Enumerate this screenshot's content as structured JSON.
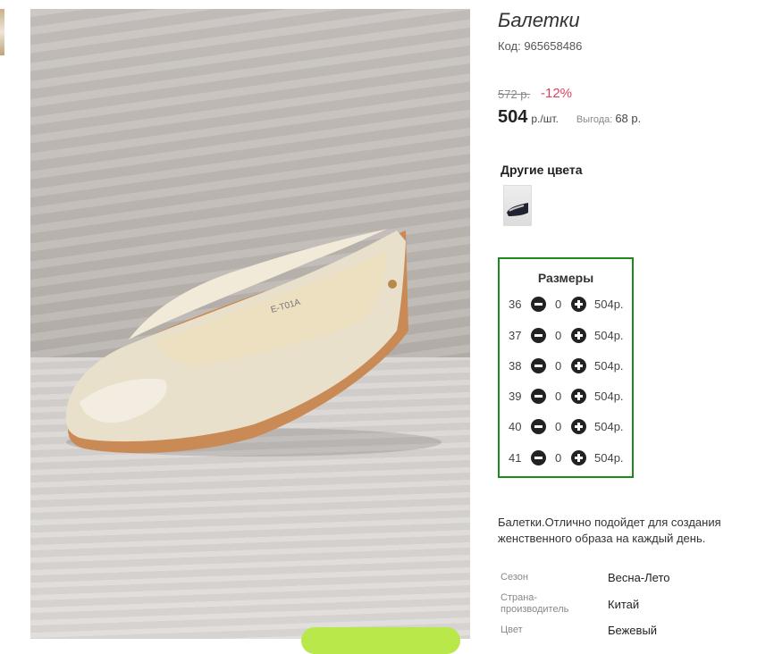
{
  "product": {
    "title": "Балетки",
    "code": "Код: 965658486",
    "old_price": "572 р.",
    "discount": "-12%",
    "price": "504",
    "unit": "р./шт.",
    "benefit_label": "Выгода:",
    "benefit_value": "68 р."
  },
  "other_colors": {
    "title": "Другие цвета"
  },
  "sizes": {
    "title": "Размеры",
    "rows": [
      {
        "size": "36",
        "qty": "0",
        "price": "504р."
      },
      {
        "size": "37",
        "qty": "0",
        "price": "504р."
      },
      {
        "size": "38",
        "qty": "0",
        "price": "504р."
      },
      {
        "size": "39",
        "qty": "0",
        "price": "504р."
      },
      {
        "size": "40",
        "qty": "0",
        "price": "504р."
      },
      {
        "size": "41",
        "qty": "0",
        "price": "504р."
      }
    ]
  },
  "description": "Балетки.Отлично подойдет для создания женственного образа на каждый день.",
  "specs": [
    {
      "label": "Сезон",
      "value": "Весна-Лето"
    },
    {
      "label": "Страна-производитель",
      "value": "Китай"
    },
    {
      "label": "Цвет",
      "value": "Бежевый"
    }
  ],
  "photo": {
    "insole_text": "E-T01A"
  },
  "colors": {
    "accent_green": "#1c8a1c",
    "discount_red": "#e0405a",
    "cart_button": "#b9e84a"
  }
}
